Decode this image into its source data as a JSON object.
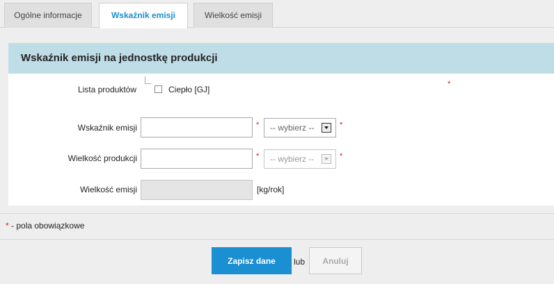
{
  "tabs": [
    {
      "label": "Ogólne informacje",
      "active": false
    },
    {
      "label": "Wskaźnik emisji",
      "active": true
    },
    {
      "label": "Wielkość emisji",
      "active": false
    }
  ],
  "panel": {
    "title": "Wskaźnik emisji na jednostkę produkcji",
    "product_list": {
      "label": "Lista produktów",
      "items": [
        {
          "label": "Ciepło [GJ]",
          "checked": false
        }
      ]
    },
    "emission_factor": {
      "label": "Wskaźnik emisji",
      "value": "",
      "select": "-- wybierz --"
    },
    "production_volume": {
      "label": "Wielkość produkcji",
      "value": "",
      "select": "-- wybierz --"
    },
    "emission_volume": {
      "label": "Wielkość emisji",
      "value": "",
      "unit": "[kg/rok]"
    },
    "required_mark": "*"
  },
  "legend": {
    "star": "*",
    "text": "- pola obowiązkowe"
  },
  "actions": {
    "save": "Zapisz dane",
    "or": "lub",
    "cancel": "Anuluj"
  },
  "colors": {
    "accent": "#1a8fd1",
    "header_bg": "#bfdde7",
    "required": "#cc2222"
  }
}
